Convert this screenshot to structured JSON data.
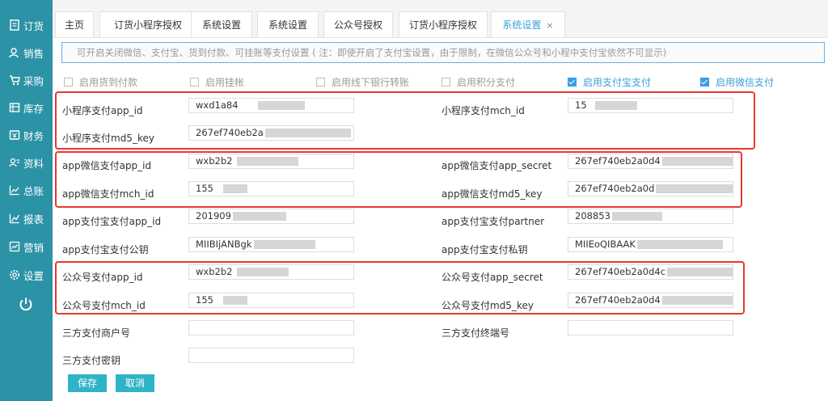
{
  "sidebar": {
    "items": [
      {
        "label": "订货",
        "icon": "order-icon"
      },
      {
        "label": "销售",
        "icon": "sales-icon"
      },
      {
        "label": "采购",
        "icon": "cart-icon"
      },
      {
        "label": "库存",
        "icon": "inventory-icon"
      },
      {
        "label": "财务",
        "icon": "finance-icon"
      },
      {
        "label": "资料",
        "icon": "profile-icon"
      },
      {
        "label": "总账",
        "icon": "ledger-icon"
      },
      {
        "label": "报表",
        "icon": "report-icon"
      },
      {
        "label": "营销",
        "icon": "marketing-icon"
      },
      {
        "label": "设置",
        "icon": "settings-icon"
      }
    ],
    "power_icon": "power-icon",
    "color": "#2c93a6"
  },
  "tabs": [
    {
      "label": "主页"
    },
    {
      "label": "订货小程序授权"
    },
    {
      "label": "系统设置"
    },
    {
      "label": "系统设置"
    },
    {
      "label": "公众号授权"
    },
    {
      "label": "订货小程序授权"
    },
    {
      "label": "系统设置",
      "close": "×"
    }
  ],
  "info_text": "可开启关闭微信、支付宝、货到付款、可挂账等支付设置 ( 注：即使开启了支付宝设置，由于限制，在微信公众号和小程中支付宝依然不可显示)",
  "options": [
    {
      "label": "启用货到付款",
      "checked": false
    },
    {
      "label": "启用挂帐",
      "checked": false
    },
    {
      "label": "启用线下银行转账",
      "checked": false
    },
    {
      "label": "启用积分支付",
      "checked": false
    },
    {
      "label": "启用支付宝支付",
      "checked": true
    },
    {
      "label": "启用微信支付",
      "checked": true
    }
  ],
  "fields": {
    "mp_app_id": {
      "label": "小程序支付app_id",
      "value": "wxd1a84"
    },
    "mp_mch_id": {
      "label": "小程序支付mch_id",
      "value": "15"
    },
    "mp_md5_key": {
      "label": "小程序支付md5_key",
      "value": "267ef740eb2a"
    },
    "app_wx_app_id": {
      "label": "app微信支付app_id",
      "value": "wxb2b2"
    },
    "app_wx_app_secret": {
      "label": "app微信支付app_secret",
      "value": "267ef740eb2a0d4"
    },
    "app_wx_mch_id": {
      "label": "app微信支付mch_id",
      "value": "155"
    },
    "app_wx_md5_key": {
      "label": "app微信支付md5_key",
      "value": "267ef740eb2a0d"
    },
    "app_ali_app_id": {
      "label": "app支付宝支付app_id",
      "value": "201909"
    },
    "app_ali_partner": {
      "label": "app支付宝支付partner",
      "value": "208853"
    },
    "app_ali_public_key": {
      "label": "app支付宝支付公钥",
      "value": "MIIBIjANBgk"
    },
    "app_ali_private_key": {
      "label": "app支付宝支付私钥",
      "value": "MIIEoQIBAAK"
    },
    "gzh_app_id": {
      "label": "公众号支付app_id",
      "value": "wxb2b2"
    },
    "gzh_app_secret": {
      "label": "公众号支付app_secret",
      "value": "267ef740eb2a0d4c"
    },
    "gzh_mch_id": {
      "label": "公众号支付mch_id",
      "value": "155"
    },
    "gzh_md5_key": {
      "label": "公众号支付md5_key",
      "value": "267ef740eb2a0d4"
    },
    "third_merchant_no": {
      "label": "三方支付商户号",
      "value": ""
    },
    "third_terminal_no": {
      "label": "三方支付终端号",
      "value": ""
    },
    "third_secret": {
      "label": "三方支付密钥",
      "value": ""
    }
  },
  "buttons": {
    "save": "保存",
    "cancel": "取消"
  },
  "colors": {
    "accent": "#3aa0d8",
    "button": "#2fb4c7",
    "highlight": "#e53935"
  }
}
